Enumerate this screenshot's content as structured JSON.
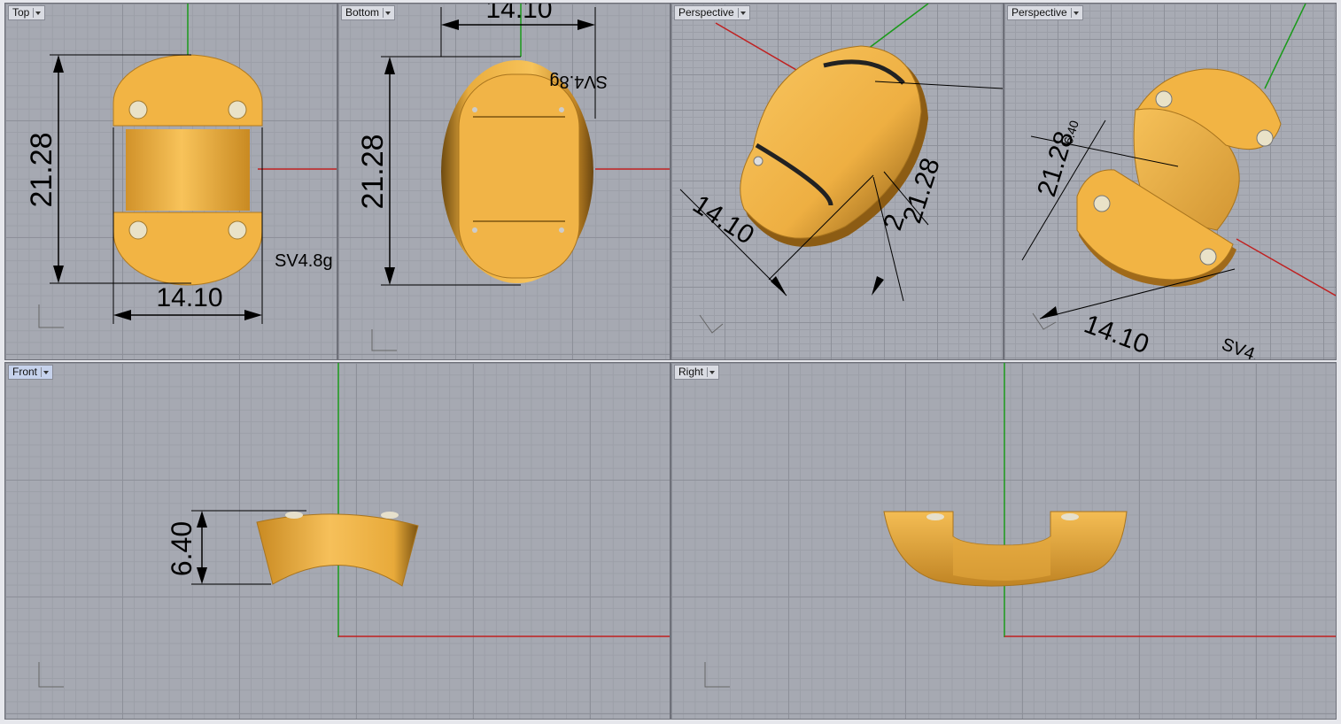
{
  "viewports": {
    "top": {
      "label": "Top"
    },
    "bottom": {
      "label": "Bottom"
    },
    "persp1": {
      "label": "Perspective"
    },
    "persp2": {
      "label": "Perspective"
    },
    "front": {
      "label": "Front"
    },
    "right": {
      "label": "Right"
    }
  },
  "dimensions": {
    "height": "21.28",
    "width": "14.10",
    "thickness": "6.40",
    "weight": "SV4.8g",
    "weight_fragment": "SV4.",
    "overlap_fragment": "2"
  },
  "colors": {
    "model": "#f2b444",
    "x_axis": "#c02020",
    "y_axis": "#1a9a1a"
  }
}
